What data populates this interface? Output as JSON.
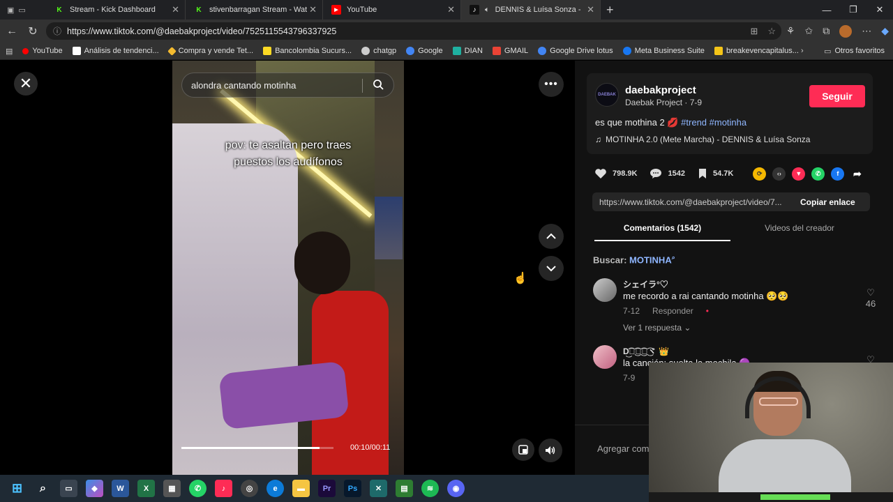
{
  "browser": {
    "tabs": [
      {
        "title": "Stream - Kick Dashboard",
        "icon": "K",
        "color": "#53fc18",
        "active": false
      },
      {
        "title": "stivenbarragan Stream - Watch Li",
        "icon": "K",
        "color": "#53fc18",
        "active": false
      },
      {
        "title": "YouTube",
        "icon": "▶",
        "color": "#ff0000",
        "active": false
      },
      {
        "title": "DENNIS & Luísa Sonza - MO",
        "icon": "♪",
        "color": "#111111",
        "active": true
      }
    ],
    "url": "https://www.tiktok.com/@daebakproject/video/7525115543796337925",
    "bookmarks": [
      {
        "label": "YouTube",
        "color": "#ff0000"
      },
      {
        "label": "Análisis de tendenci...",
        "color": "#ffffff"
      },
      {
        "label": "Compra y vende Tet...",
        "color": "#f3ba2f"
      },
      {
        "label": "Bancolombia Sucurs...",
        "color": "#fdda24"
      },
      {
        "label": "chatgp",
        "color": "#cccccc"
      },
      {
        "label": "Google",
        "color": "#4285f4"
      },
      {
        "label": "DIAN",
        "color": "#1fb0a0"
      },
      {
        "label": "GMAIL",
        "color": "#ea4335"
      },
      {
        "label": "Google Drive lotus",
        "color": "#4285f4"
      },
      {
        "label": "Meta Business Suite",
        "color": "#1877f2"
      },
      {
        "label": "breakevencapitalus...",
        "color": "#f5c518"
      }
    ],
    "bookmarks_more": "›",
    "other_favorites": "Otros favoritos"
  },
  "video": {
    "search_text": "alondra cantando motinha",
    "caption_line1": "pov: te asaltan pero traes",
    "caption_line2": "puestos los audífonos",
    "time": "00:10/00:11",
    "progress": 0.91
  },
  "post": {
    "username": "daebakproject",
    "display_name": "Daebak Project · 7-9",
    "avatar_text": "DAEBAK",
    "follow_label": "Seguir",
    "description": "es que mothina 2",
    "description_emoji": "💋",
    "hashtags": "#trend #motinha",
    "music": "MOTINHA 2.0 (Mete Marcha) - DENNIS & Luísa Sonza",
    "likes": "798.9K",
    "comments": "1542",
    "saves": "54.7K",
    "link": "https://www.tiktok.com/@daebakproject/video/7...",
    "copy_label": "Copiar enlace"
  },
  "tabs": {
    "comments": "Comentarios (1542)",
    "creator_videos": "Videos del creador"
  },
  "search": {
    "label": "Buscar:",
    "term": "MOTINHA"
  },
  "comments": [
    {
      "name": "シェイラ°♡",
      "text": "me recordo a rai cantando motinha 🥺🥺",
      "date": "7-12",
      "reply": "Responder",
      "likes": "46",
      "replies": "Ver 1 respuesta"
    },
    {
      "name": "D͜͡ヾ͜͡ヾ͜͡ヾ͜͡ヾ 👑",
      "text": "la canción: suelta la mochila 🟣",
      "date": "7-9",
      "reply": "",
      "likes": "",
      "replies": ""
    }
  ],
  "add_comment_placeholder": "Agregar comentario..."
}
